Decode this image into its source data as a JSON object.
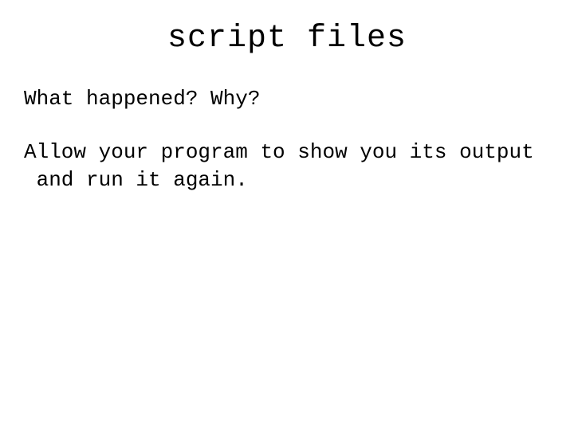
{
  "title": "script files",
  "paragraphs": {
    "p1": "What happened? Why?",
    "p2": "Allow your program to show you its output and run it again."
  }
}
